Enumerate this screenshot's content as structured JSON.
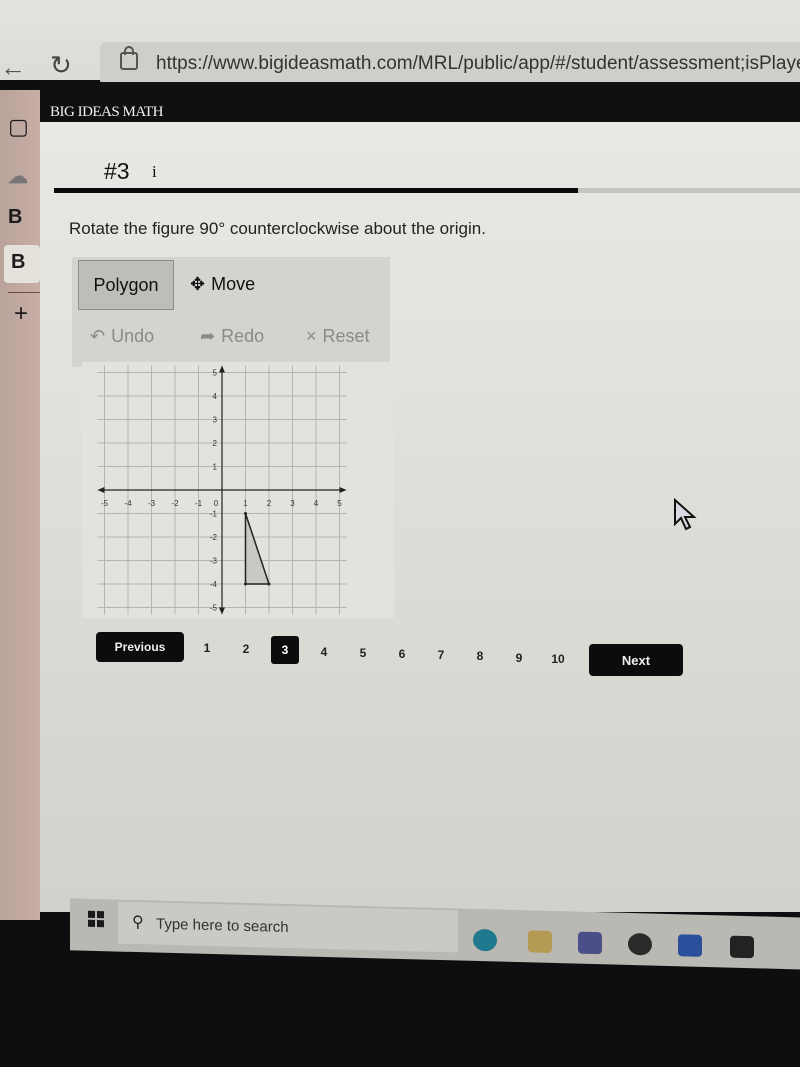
{
  "browser": {
    "url": "https://www.bigideasmath.com/MRL/public/app/#/student/assessment;isPlayer",
    "back_icon": "arrow-left-icon",
    "reload_icon": "reload-icon",
    "lock_icon": "lock-icon"
  },
  "sidebar": {
    "items": [
      {
        "icon": "tab-manager-icon",
        "glyph": "▢"
      },
      {
        "icon": "cloud-icon",
        "glyph": "☁"
      },
      {
        "icon": "b-tab-icon",
        "glyph": "B"
      },
      {
        "icon": "b-tab-active-icon",
        "glyph": "B"
      },
      {
        "icon": "plus-icon",
        "glyph": "+"
      }
    ]
  },
  "header": {
    "logo": "BIG IDEAS MATH"
  },
  "question": {
    "number": "#3",
    "info_glyph": "i",
    "progress_fraction": 0.69,
    "prompt": "Rotate the figure 90° counterclockwise about the origin."
  },
  "tools": {
    "polygon_label": "Polygon",
    "move_label": "Move",
    "move_glyph": "✥",
    "undo_label": "Undo",
    "undo_glyph": "↶",
    "redo_label": "Redo",
    "redo_glyph": "➦",
    "reset_label": "Reset",
    "reset_glyph": "×"
  },
  "graph": {
    "x_range": [
      -5,
      5
    ],
    "y_range": [
      -5,
      5
    ],
    "x_ticks": [
      "-5",
      "-4",
      "-3",
      "-2",
      "-1",
      "1",
      "2",
      "3",
      "4",
      "5"
    ],
    "y_ticks": [
      "5",
      "4",
      "3",
      "2",
      "1",
      "-1",
      "-2",
      "-3",
      "-4",
      "-5"
    ],
    "origin_label": "0",
    "triangle": [
      [
        1,
        -1
      ],
      [
        1,
        -4
      ],
      [
        2,
        -4
      ]
    ],
    "colors": {
      "grid": "#b4b4b0",
      "axis": "#222222",
      "shape_fill": "#c8c8c4",
      "shape_stroke": "#222222"
    }
  },
  "pagination": {
    "previous_label": "Previous",
    "next_label": "Next",
    "pages": [
      "1",
      "2",
      "3",
      "4",
      "5",
      "6",
      "7",
      "8",
      "9",
      "10"
    ],
    "current": "3"
  },
  "taskbar": {
    "search_placeholder": "Type here to search",
    "apps": [
      "edge-icon",
      "file-explorer-icon",
      "teams-icon",
      "snip-icon",
      "word-icon",
      "store-icon"
    ]
  }
}
